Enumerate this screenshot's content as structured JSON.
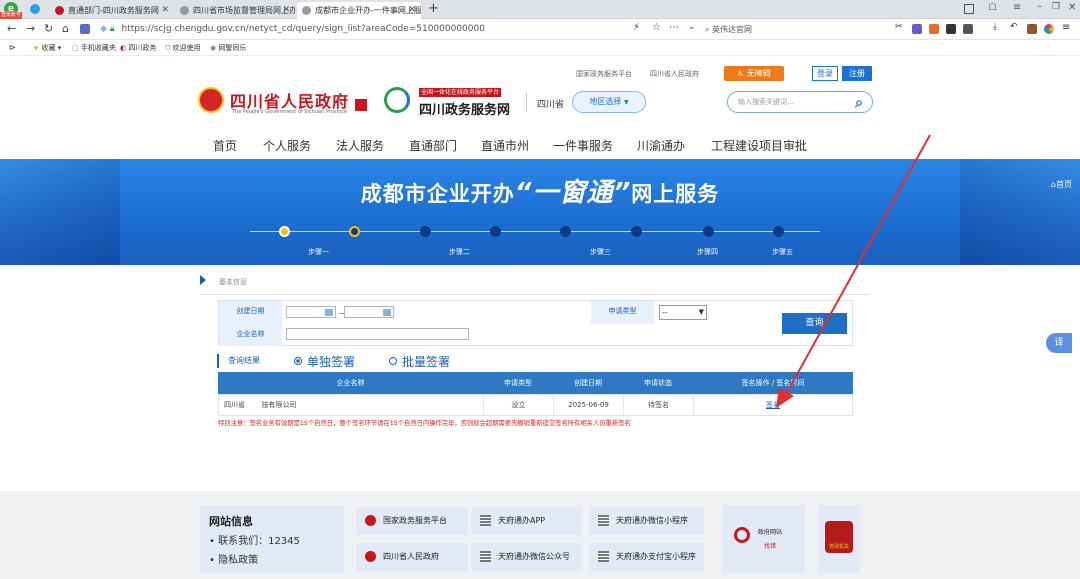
{
  "browser": {
    "badge": "登录账号",
    "tabs": [
      {
        "title": "直通部门-四川政务服务网"
      },
      {
        "title": "四川省市场监督管理局网上办"
      },
      {
        "title": "成都市企业开办-一件事网上服"
      }
    ],
    "new_tab": "+",
    "url": "https://scjg.chengdu.gov.cn/netyct_cd/query/sign_list?areaCode=510000000000",
    "search_placeholder": "英伟达官网",
    "bookmarks": [
      "收藏",
      "手机收藏夹",
      "四川政务",
      "欢迎使用",
      "网警同乐"
    ]
  },
  "header": {
    "top_links": [
      "国家政务服务平台",
      "四川省人民政府"
    ],
    "accessibility": "无障碍",
    "login": "登录",
    "register": "注册",
    "gov_title": "四川省人民政府",
    "gov_subtitle": "The People's Government of Sichuan Province",
    "service_badge": "全国一体化在线政务服务平台",
    "service_title": "四川政务服务网",
    "province": "四川省",
    "region_select": "地区选择",
    "search_placeholder": "输入搜索关键词...",
    "nav": [
      "首页",
      "个人服务",
      "法人服务",
      "直通部门",
      "直通市州",
      "一件事服务",
      "川渝通办",
      "工程建设项目审批"
    ]
  },
  "banner": {
    "title_left": "成都市企业开办",
    "title_mid": "“一窗通”",
    "title_right": "网上服务",
    "home": "首页",
    "steps": [
      "步骤一",
      "步骤二",
      "步骤三",
      "步骤四",
      "步骤五"
    ]
  },
  "search_form": {
    "section_label": "基本信息",
    "created_date_label": "创建日期",
    "date_sep": "~",
    "app_type_label": "申请类型",
    "app_type_value": "--",
    "company_name_label": "企业名称",
    "query_button": "查询"
  },
  "results": {
    "header": "查询结果",
    "radio_single": "单独签署",
    "radio_batch": "批量签署",
    "columns": [
      "企业名称",
      "申请类型",
      "创建日期",
      "申请状态",
      "签名操作 / 签名时间"
    ],
    "rows": [
      {
        "company_prefix": "四川省",
        "company_suffix": "技有限公司",
        "type": "设立",
        "date": "2025-06-09",
        "status": "待签名",
        "action": "签名"
      }
    ],
    "notice": "特别注意：签名业务有效期是15个自然日，整个签名环节请在15个自然日内操作完毕，否则就会超期需要先撤销重新提交签名所有相关人员重新签名"
  },
  "floating_button": "译",
  "footer": {
    "site_info_title": "网站信息",
    "contact": "联系我们：12345",
    "privacy": "隐私政策",
    "links": [
      "国家政务服务平台",
      "天府通办APP",
      "天府通办微信小程序",
      "四川省人民政府",
      "天府通办微信公众号",
      "天府通办支付宝小程序"
    ],
    "error_title": "政府网站",
    "error_sub": "找错",
    "party_badge": "党政机关"
  },
  "colors": {
    "brand_blue": "#1a72d6",
    "banner_blue": "#1e6fd3",
    "gov_red": "#c8161d",
    "accent_orange": "#f07a1a",
    "annotation_red": "#e03030"
  }
}
